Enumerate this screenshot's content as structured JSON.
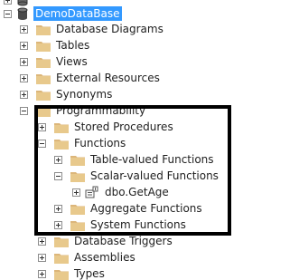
{
  "tree": {
    "root_label": "DemoDataBase",
    "items": [
      {
        "label": "Database Diagrams",
        "expander": "plus"
      },
      {
        "label": "Tables",
        "expander": "plus"
      },
      {
        "label": "Views",
        "expander": "plus"
      },
      {
        "label": "External Resources",
        "expander": "plus"
      },
      {
        "label": "Synonyms",
        "expander": "plus"
      },
      {
        "label": "Programmability",
        "expander": "minus"
      },
      {
        "label": "Stored Procedures",
        "expander": "plus"
      },
      {
        "label": "Functions",
        "expander": "minus"
      },
      {
        "label": "Table-valued Functions",
        "expander": "plus"
      },
      {
        "label": "Scalar-valued Functions",
        "expander": "minus"
      },
      {
        "label": "dbo.GetAge",
        "expander": "plus"
      },
      {
        "label": "Aggregate Functions",
        "expander": "plus"
      },
      {
        "label": "System Functions",
        "expander": "plus"
      },
      {
        "label": "Database Triggers",
        "expander": "plus"
      },
      {
        "label": "Assemblies",
        "expander": "plus"
      },
      {
        "label": "Types",
        "expander": "plus"
      }
    ]
  },
  "colors": {
    "selection": "#3399ff",
    "folder": "#dcb67a",
    "highlight_border": "#000000"
  },
  "icons": {
    "database": "database-icon",
    "folder": "folder-icon",
    "function": "scalar-function-icon"
  }
}
